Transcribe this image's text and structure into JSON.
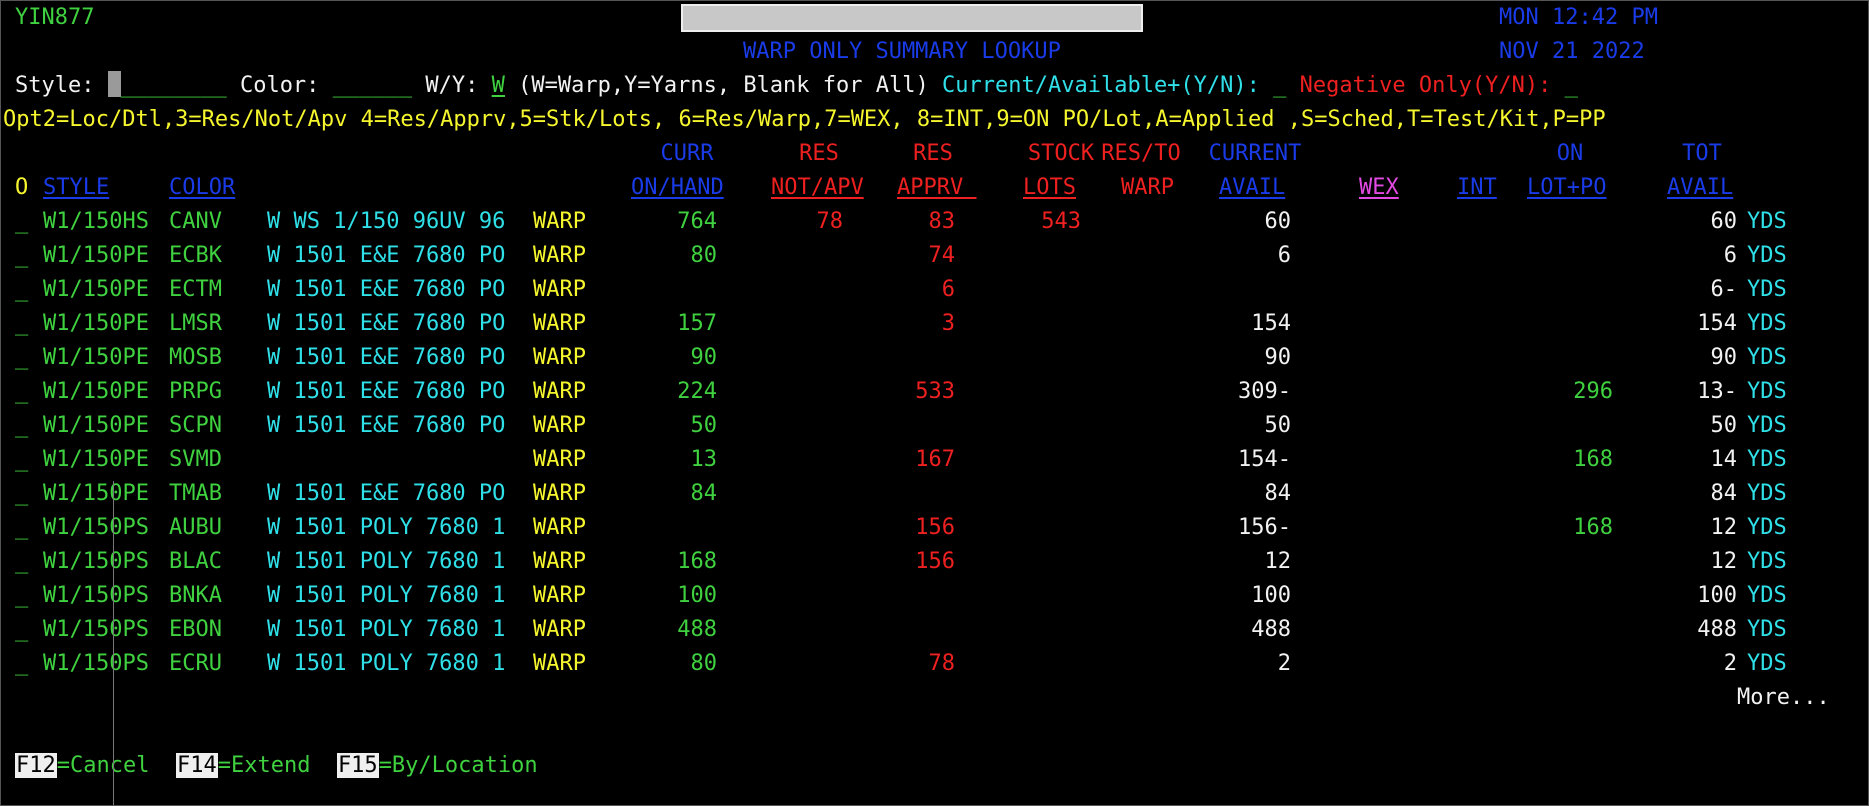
{
  "header": {
    "session_id": "YIN877",
    "program_title": "WARP ONLY SUMMARY LOOKUP",
    "day_time": "MON 12:42 PM",
    "date": "NOV 21 2022"
  },
  "filters": {
    "style_label": "Style:",
    "style_value": "________",
    "color_label": "Color:",
    "color_value": "______",
    "wy_label": "W/Y:",
    "wy_value": "W",
    "wy_hint": "(W=Warp,Y=Yarns, Blank for All)",
    "current_label": "Current/Available+(Y/N):",
    "current_value": "_",
    "negative_label": "Negative Only(Y/N):",
    "negative_value": "_"
  },
  "options_line": "Opt2=Loc/Dtl,3=Res/Not/Apv 4=Res/Apprv,5=Stk/Lots, 6=Res/Warp,7=WEX, 8=INT,9=ON PO/Lot,A=Applied ,S=Sched,T=Test/Kit,P=PP",
  "columns": {
    "opt": "O",
    "style": "STYLE",
    "color": "COLOR",
    "curr_top": "CURR",
    "curr_bottom": "ON/HAND",
    "res_not_top": "RES",
    "res_not_bottom": "NOT/APV",
    "res_apprv_top": "RES",
    "res_apprv_bottom": "APPRV ",
    "stock_top": "STOCK",
    "stock_bottom": "LOTS",
    "res_warp_top": "RES/TO",
    "res_warp_bottom": "WARP",
    "current_top": "CURRENT",
    "current_bottom": "AVAIL",
    "wex": "WEX",
    "int": "INT",
    "on_top": "ON",
    "on_bottom": "LOT+PO",
    "tot_top": "TOT",
    "tot_bottom": "AVAIL"
  },
  "rows": [
    {
      "opt": "_",
      "style": "W1/150HS",
      "color": "CANV",
      "desc": "W WS 1/150 96UV 96",
      "type": "WARP",
      "on_hand": "764",
      "res_not": "78",
      "res_apprv": "83",
      "stock_lots": "543",
      "avail": "60",
      "on_lot_po": "",
      "tot_avail": "60",
      "uom": "YDS"
    },
    {
      "opt": "_",
      "style": "W1/150PE",
      "color": "ECBK",
      "desc": "W 1501 E&E 7680 PO",
      "type": "WARP",
      "on_hand": "80",
      "res_not": "",
      "res_apprv": "74",
      "stock_lots": "",
      "avail": "6",
      "on_lot_po": "",
      "tot_avail": "6",
      "uom": "YDS"
    },
    {
      "opt": "_",
      "style": "W1/150PE",
      "color": "ECTM",
      "desc": "W 1501 E&E 7680 PO",
      "type": "WARP",
      "on_hand": "",
      "res_not": "",
      "res_apprv": "6",
      "stock_lots": "",
      "avail": "",
      "on_lot_po": "",
      "tot_avail": "6-",
      "uom": "YDS"
    },
    {
      "opt": "_",
      "style": "W1/150PE",
      "color": "LMSR",
      "desc": "W 1501 E&E 7680 PO",
      "type": "WARP",
      "on_hand": "157",
      "res_not": "",
      "res_apprv": "3",
      "stock_lots": "",
      "avail": "154",
      "on_lot_po": "",
      "tot_avail": "154",
      "uom": "YDS"
    },
    {
      "opt": "_",
      "style": "W1/150PE",
      "color": "MOSB",
      "desc": "W 1501 E&E 7680 PO",
      "type": "WARP",
      "on_hand": "90",
      "res_not": "",
      "res_apprv": "",
      "stock_lots": "",
      "avail": "90",
      "on_lot_po": "",
      "tot_avail": "90",
      "uom": "YDS"
    },
    {
      "opt": "_",
      "style": "W1/150PE",
      "color": "PRPG",
      "desc": "W 1501 E&E 7680 PO",
      "type": "WARP",
      "on_hand": "224",
      "res_not": "",
      "res_apprv": "533",
      "stock_lots": "",
      "avail": "309-",
      "on_lot_po": "296",
      "tot_avail": "13-",
      "uom": "YDS"
    },
    {
      "opt": "_",
      "style": "W1/150PE",
      "color": "SCPN",
      "desc": "W 1501 E&E 7680 PO",
      "type": "WARP",
      "on_hand": "50",
      "res_not": "",
      "res_apprv": "",
      "stock_lots": "",
      "avail": "50",
      "on_lot_po": "",
      "tot_avail": "50",
      "uom": "YDS"
    },
    {
      "opt": "_",
      "style": "W1/150PE",
      "color": "SVMD",
      "desc": "",
      "type": "WARP",
      "on_hand": "13",
      "res_not": "",
      "res_apprv": "167",
      "stock_lots": "",
      "avail": "154-",
      "on_lot_po": "168",
      "tot_avail": "14",
      "uom": "YDS"
    },
    {
      "opt": "_",
      "style": "W1/150PE",
      "color": "TMAB",
      "desc": "W 1501 E&E 7680 PO",
      "type": "WARP",
      "on_hand": "84",
      "res_not": "",
      "res_apprv": "",
      "stock_lots": "",
      "avail": "84",
      "on_lot_po": "",
      "tot_avail": "84",
      "uom": "YDS"
    },
    {
      "opt": "_",
      "style": "W1/150PS",
      "color": "AUBU",
      "desc": "W 1501 POLY 7680 1",
      "type": "WARP",
      "on_hand": "",
      "res_not": "",
      "res_apprv": "156",
      "stock_lots": "",
      "avail": "156-",
      "on_lot_po": "168",
      "tot_avail": "12",
      "uom": "YDS"
    },
    {
      "opt": "_",
      "style": "W1/150PS",
      "color": "BLAC",
      "desc": "W 1501 POLY 7680 1",
      "type": "WARP",
      "on_hand": "168",
      "res_not": "",
      "res_apprv": "156",
      "stock_lots": "",
      "avail": "12",
      "on_lot_po": "",
      "tot_avail": "12",
      "uom": "YDS"
    },
    {
      "opt": "_",
      "style": "W1/150PS",
      "color": "BNKA",
      "desc": "W 1501 POLY 7680 1",
      "type": "WARP",
      "on_hand": "100",
      "res_not": "",
      "res_apprv": "",
      "stock_lots": "",
      "avail": "100",
      "on_lot_po": "",
      "tot_avail": "100",
      "uom": "YDS"
    },
    {
      "opt": "_",
      "style": "W1/150PS",
      "color": "EBON",
      "desc": "W 1501 POLY 7680 1",
      "type": "WARP",
      "on_hand": "488",
      "res_not": "",
      "res_apprv": "",
      "stock_lots": "",
      "avail": "488",
      "on_lot_po": "",
      "tot_avail": "488",
      "uom": "YDS"
    },
    {
      "opt": "_",
      "style": "W1/150PS",
      "color": "ECRU",
      "desc": "W 1501 POLY 7680 1",
      "type": "WARP",
      "on_hand": "80",
      "res_not": "",
      "res_apprv": "78",
      "stock_lots": "",
      "avail": "2",
      "on_lot_po": "",
      "tot_avail": "2",
      "uom": "YDS"
    }
  ],
  "more": "More...",
  "fkeys": [
    {
      "key": "F12",
      "label": "=Cancel"
    },
    {
      "key": "F14",
      "label": "=Extend"
    },
    {
      "key": "F15",
      "label": "=By/Location"
    }
  ],
  "colors": {
    "background": "#000000",
    "green": "#3fd13f",
    "white": "#f2f2f2",
    "yellow": "#f6f62e",
    "blue": "#1a3be8",
    "cyan": "#30e0e8",
    "red": "#ee2020",
    "pink": "#e34ae3"
  }
}
